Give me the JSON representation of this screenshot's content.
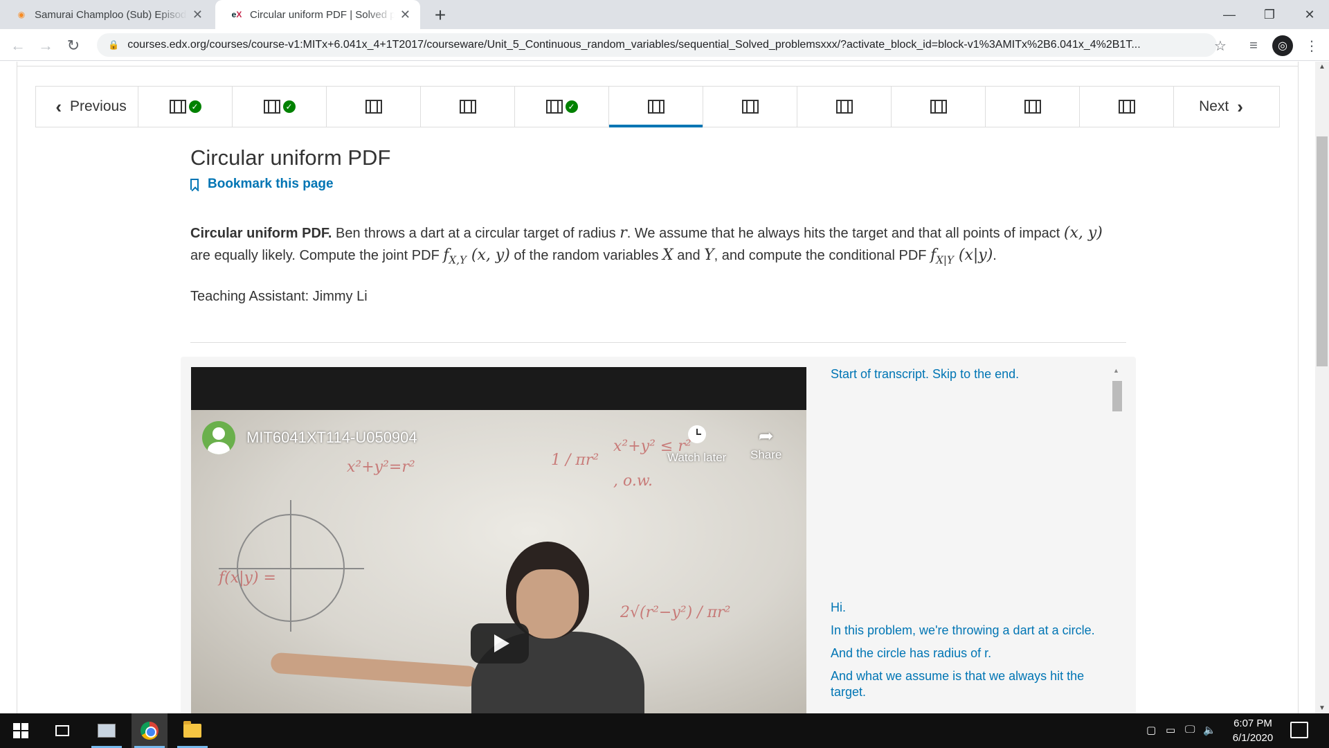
{
  "browser": {
    "tabs": [
      {
        "title": "Samurai Champloo (Sub) Episode",
        "favicon": "crunchyroll-icon"
      },
      {
        "title": "Circular uniform PDF | Solved pro",
        "favicon": "edx-icon"
      }
    ],
    "url": "courses.edx.org/courses/course-v1:MITx+6.041x_4+1T2017/courseware/Unit_5_Continuous_random_variables/sequential_Solved_problemsxxx/?activate_block_id=block-v1%3AMITx%2B6.041x_4%2B1T..."
  },
  "seq_nav": {
    "previous_label": "Previous",
    "next_label": "Next",
    "units": [
      {
        "icon": "video-icon",
        "completed": true
      },
      {
        "icon": "video-icon",
        "completed": true
      },
      {
        "icon": "video-icon",
        "completed": false
      },
      {
        "icon": "video-icon",
        "completed": false
      },
      {
        "icon": "video-icon",
        "completed": true
      },
      {
        "icon": "video-icon",
        "completed": false,
        "active": true
      },
      {
        "icon": "video-icon",
        "completed": false
      },
      {
        "icon": "video-icon",
        "completed": false
      },
      {
        "icon": "video-icon",
        "completed": false
      },
      {
        "icon": "video-icon",
        "completed": false
      },
      {
        "icon": "video-icon",
        "completed": false
      }
    ]
  },
  "content": {
    "title": "Circular uniform PDF",
    "bookmark_label": "Bookmark this page",
    "problem_bold": "Circular uniform PDF.",
    "problem_text_1": " Ben throws a dart at a circular target of radius ",
    "math_r": "r",
    "problem_text_2": ". We assume that he always hits the target and that all points of impact ",
    "math_xy": "(x, y)",
    "problem_text_3": " are equally likely. Compute the joint PDF ",
    "math_joint": "f",
    "math_joint_sub": "X,Y",
    "math_joint_arg": " (x, y)",
    "problem_text_4": " of the random variables ",
    "math_X": "X",
    "problem_text_5": " and ",
    "math_Y": "Y",
    "problem_text_6": ", and compute the conditional PDF ",
    "math_cond": "f",
    "math_cond_sub": "X|Y",
    "math_cond_arg": " (x|y)",
    "problem_text_7": ".",
    "ta": "Teaching Assistant: Jimmy Li"
  },
  "video": {
    "channel_title": "MIT6041XT114-U050904",
    "watch_later": "Watch later",
    "share": "Share"
  },
  "transcript": {
    "skip": "Start of transcript. Skip to the end.",
    "lines": [
      "Hi.",
      "In this problem, we're throwing a dart at a circle.",
      "And the circle has radius of r.",
      "And what we assume is that we always hit the target."
    ]
  },
  "taskbar": {
    "time": "6:07 PM",
    "date": "6/1/2020"
  },
  "colors": {
    "link": "#0075b4",
    "check": "#008100"
  }
}
